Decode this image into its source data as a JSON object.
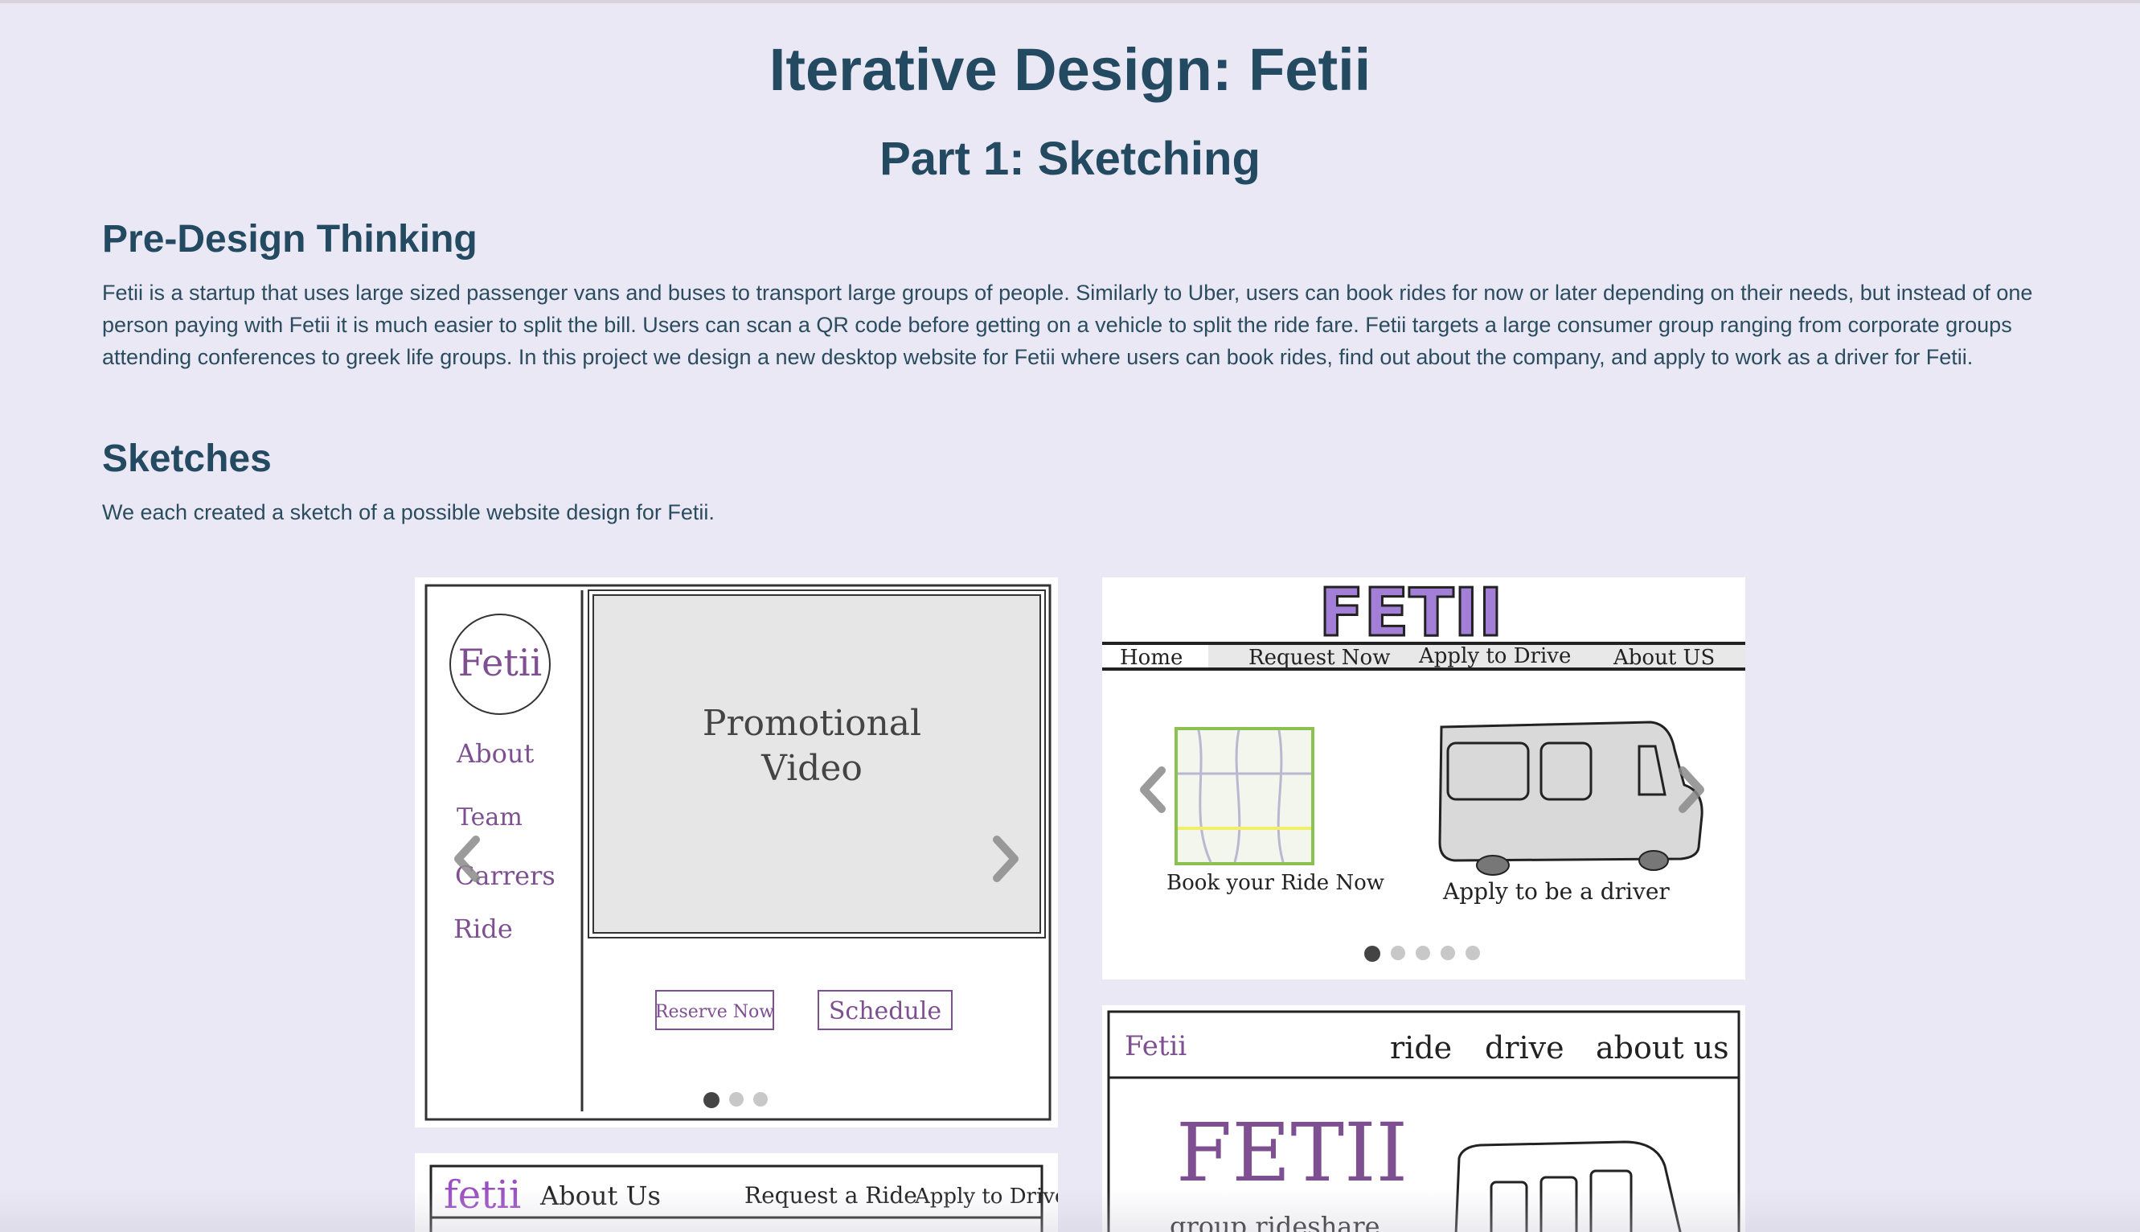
{
  "page": {
    "title": "Iterative Design: Fetii",
    "subtitle": "Part 1: Sketching"
  },
  "pre_design": {
    "heading": "Pre-Design Thinking",
    "body": "Fetii is a startup that uses large sized passenger vans and buses to transport large groups of people. Similarly to Uber, users can book rides for now or later depending on their needs, but instead of one person paying with Fetii it is much easier to split the bill. Users can scan a QR code before getting on a vehicle to split the ride fare. Fetii targets a large consumer group ranging from corporate groups attending conferences to greek life groups. In this project we design a new desktop website for Fetii where users can book rides, find out about the company, and apply to work as a driver for Fetii."
  },
  "sketches": {
    "heading": "Sketches",
    "intro": "We each created a sketch of a possible website design for Fetii.",
    "sketch1": {
      "logo": "Fetii",
      "nav": [
        "About",
        "Team",
        "Carrers",
        "Ride"
      ],
      "video_line1": "Promotional",
      "video_line2": "Video",
      "button1": "Reserve Now",
      "button2": "Schedule",
      "carousel_dots": 3,
      "active_dot": 0
    },
    "sketch2": {
      "logo": "FETII",
      "nav": [
        "Home",
        "Request Now",
        "Apply to Drive",
        "About US"
      ],
      "caption_left": "Book your Ride Now",
      "caption_right": "Apply to be a driver",
      "carousel_dots": 5,
      "active_dot": 0
    },
    "sketch3": {
      "logo": "Fetii",
      "nav": [
        "ride",
        "drive",
        "about us"
      ],
      "hero": "FETII",
      "tagline": "group rideshare"
    },
    "sketch4": {
      "logo": "fetii",
      "nav": [
        "About Us",
        "Request a Ride",
        "Apply to Drive"
      ]
    },
    "colors": {
      "purple": "#a37fd8",
      "purple_dark": "#7e4f91",
      "map_green": "#8cc152"
    }
  }
}
